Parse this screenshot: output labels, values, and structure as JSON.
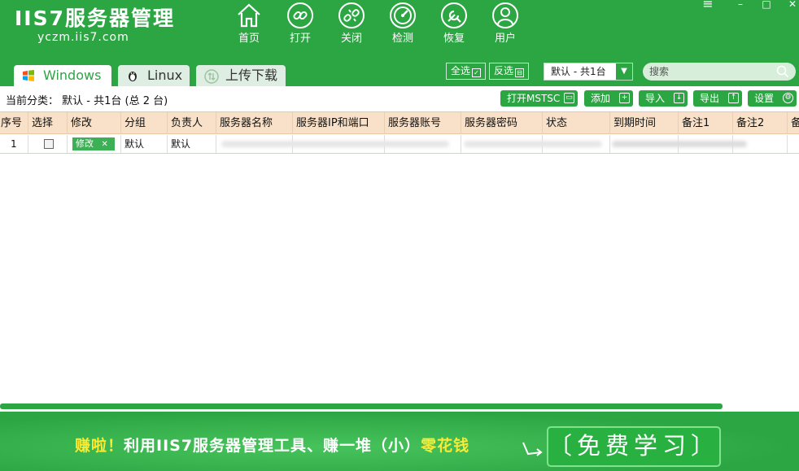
{
  "app": {
    "logo_title": "IIS7服务器管理",
    "logo_subtitle": "yczm.iis7.com"
  },
  "nav": [
    {
      "label": "首页",
      "icon": "home-icon"
    },
    {
      "label": "打开",
      "icon": "link-icon"
    },
    {
      "label": "关闭",
      "icon": "unlink-icon"
    },
    {
      "label": "检测",
      "icon": "speedometer-icon"
    },
    {
      "label": "恢复",
      "icon": "wrench-icon"
    },
    {
      "label": "用户",
      "icon": "user-icon"
    }
  ],
  "window_controls": {
    "menu": "≡",
    "minimize": "–",
    "maximize": "□",
    "close": "✕"
  },
  "tabs": [
    {
      "label": "Windows",
      "icon": "windows-icon",
      "active": true
    },
    {
      "label": "Linux",
      "icon": "penguin-icon",
      "active": false
    },
    {
      "label": "上传下载",
      "icon": "transfer-icon",
      "active": false
    }
  ],
  "header_actions": {
    "select_all": "全选",
    "invert_select": "反选",
    "group_selected": "默认 - 共1台",
    "search_placeholder": "搜索"
  },
  "toolbar": {
    "current_category": "当前分类： 默认 - 共1台 (总 2 台)",
    "open_mstsc": "打开MSTSC",
    "add": "添加",
    "import": "导入",
    "export": "导出",
    "settings": "设置"
  },
  "table": {
    "columns": [
      "序号",
      "选择",
      "修改",
      "分组",
      "负责人",
      "服务器名称",
      "服务器IP和端口",
      "服务器账号",
      "服务器密码",
      "状态",
      "到期时间",
      "备注1",
      "备注2",
      "备"
    ],
    "rows": [
      {
        "index": "1",
        "edit_label": "修改",
        "group": "默认",
        "owner": "默认"
      }
    ]
  },
  "banner": {
    "part1": "赚啦！",
    "part2": "利用IIS7服务器管理工具、赚一堆（小）",
    "part3": "零花钱",
    "button": "〔免费学习〕"
  },
  "colors": {
    "primary_green": "#2ca643",
    "header_row": "#f8e1c8",
    "highlight_yellow": "#f8ea35"
  }
}
